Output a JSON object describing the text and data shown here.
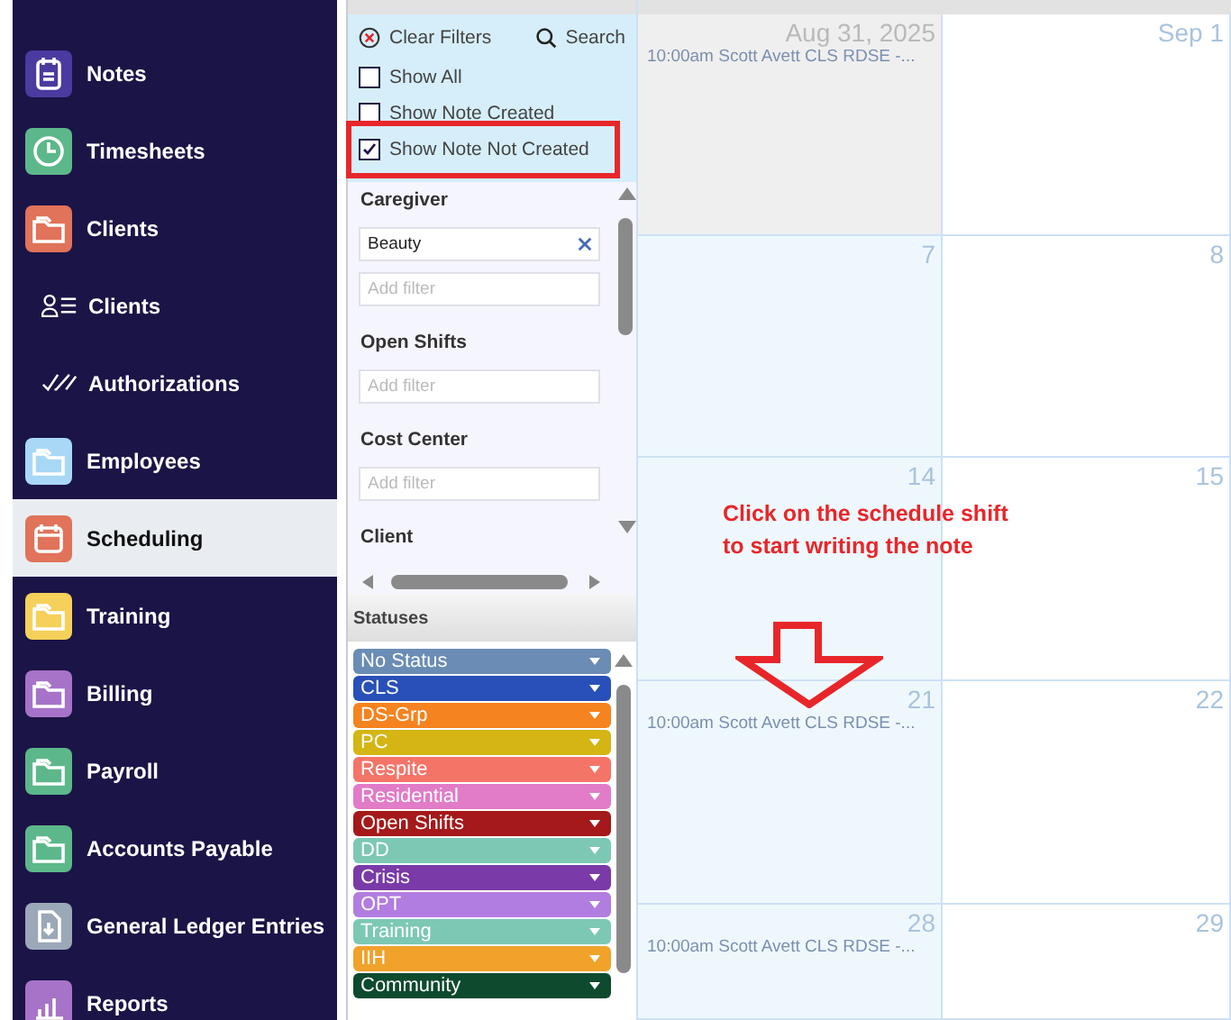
{
  "sidebar": {
    "items": [
      {
        "label": "Notes",
        "kind": "main",
        "color": "#4b3aa0",
        "selected": false
      },
      {
        "label": "Timesheets",
        "kind": "main",
        "color": "#5cb88a",
        "selected": false
      },
      {
        "label": "Clients",
        "kind": "main",
        "color": "#e0735a",
        "selected": false
      },
      {
        "label": "Clients",
        "kind": "sub",
        "selected": false
      },
      {
        "label": "Authorizations",
        "kind": "sub",
        "selected": false
      },
      {
        "label": "Employees",
        "kind": "main",
        "color": "#a8d8f5",
        "selected": false
      },
      {
        "label": "Scheduling",
        "kind": "main",
        "color": "#e0735a",
        "selected": true
      },
      {
        "label": "Training",
        "kind": "main",
        "color": "#f5d05a",
        "selected": false
      },
      {
        "label": "Billing",
        "kind": "main",
        "color": "#a673c8",
        "selected": false
      },
      {
        "label": "Payroll",
        "kind": "main",
        "color": "#5cb88a",
        "selected": false
      },
      {
        "label": "Accounts Payable",
        "kind": "main",
        "color": "#5cb88a",
        "selected": false
      },
      {
        "label": "General Ledger Entries",
        "kind": "main",
        "color": "#9aa8b8",
        "selected": false
      },
      {
        "label": "Reports",
        "kind": "main",
        "color": "#a673c8",
        "selected": false
      }
    ]
  },
  "filters": {
    "clear_label": "Clear Filters",
    "search_label": "Search",
    "options": [
      {
        "label": "Show All",
        "checked": false
      },
      {
        "label": "Show Note Created",
        "checked": false
      },
      {
        "label": "Show Note Not Created",
        "checked": true
      }
    ],
    "groups": [
      {
        "title": "Caregiver",
        "values": [
          "Beauty"
        ],
        "placeholder": "Add filter"
      },
      {
        "title": "Open Shifts",
        "placeholder": "Add filter"
      },
      {
        "title": "Cost Center",
        "placeholder": "Add filter"
      },
      {
        "title": "Client"
      }
    ]
  },
  "statuses": {
    "title": "Statuses",
    "items": [
      {
        "label": "No Status",
        "color": "#6a8cb5"
      },
      {
        "label": "CLS",
        "color": "#2950b8"
      },
      {
        "label": "DS-Grp",
        "color": "#f5831f"
      },
      {
        "label": "PC",
        "color": "#d4b514"
      },
      {
        "label": "Respite",
        "color": "#f57468"
      },
      {
        "label": "Residential",
        "color": "#e27bc8"
      },
      {
        "label": "Open Shifts",
        "color": "#a5191b"
      },
      {
        "label": "DD",
        "color": "#7cc8b5"
      },
      {
        "label": "Crisis",
        "color": "#7a3aa8"
      },
      {
        "label": "OPT",
        "color": "#b27de0"
      },
      {
        "label": "Training",
        "color": "#7cc8b5"
      },
      {
        "label": "IIH",
        "color": "#f0a22a"
      },
      {
        "label": "Community",
        "color": "#0e4a2e"
      }
    ]
  },
  "calendar": {
    "cells": [
      {
        "date": "Aug 31, 2025",
        "other_month": true,
        "events": [
          "10:00am Scott Avett CLS RDSE -..."
        ]
      },
      {
        "date": "Sep 1",
        "other_month": false
      },
      {
        "date": "7",
        "other_month": false
      },
      {
        "date": "8",
        "other_month": false
      },
      {
        "date": "14",
        "other_month": false
      },
      {
        "date": "15",
        "other_month": false
      },
      {
        "date": "21",
        "other_month": false,
        "events": [
          "10:00am Scott Avett CLS RDSE -..."
        ]
      },
      {
        "date": "22",
        "other_month": false
      },
      {
        "date": "28",
        "other_month": false,
        "events": [
          "10:00am Scott Avett CLS RDSE -..."
        ]
      },
      {
        "date": "29",
        "other_month": false
      }
    ]
  },
  "annotation": {
    "lines": [
      "Click on the schedule shift",
      "to start writing the note"
    ]
  }
}
